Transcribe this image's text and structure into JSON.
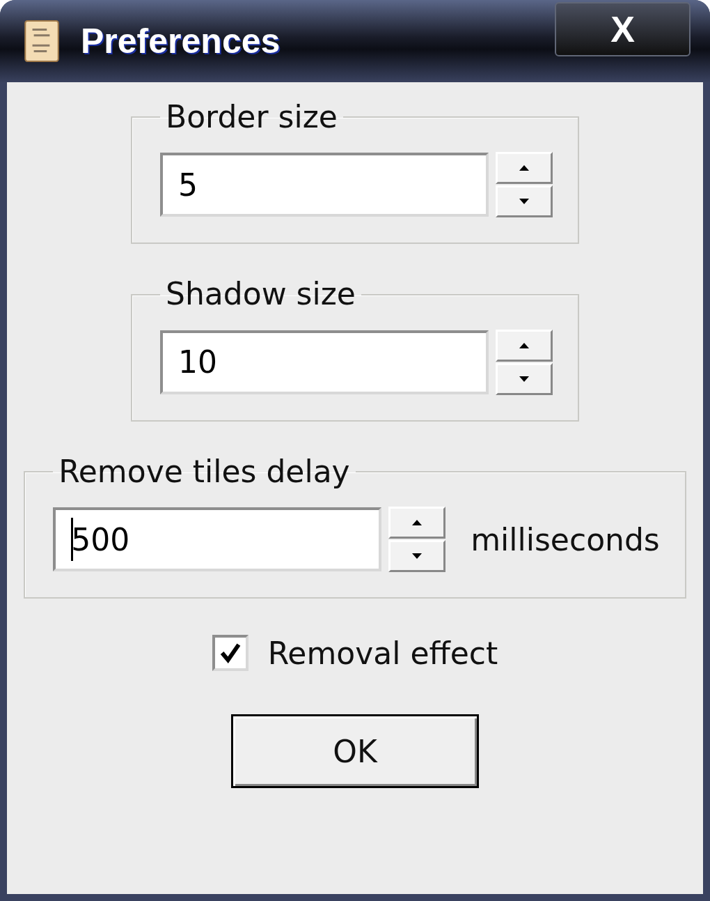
{
  "window": {
    "title": "Preferences",
    "close_label": "X"
  },
  "groups": [
    {
      "label": "Border size",
      "value": "5",
      "focused": false
    },
    {
      "label": "Shadow size",
      "value": "10",
      "focused": false
    },
    {
      "label": "Remove tiles delay",
      "value": "500",
      "focused": true,
      "unit": "milliseconds"
    }
  ],
  "checkbox": {
    "label": "Removal effect",
    "checked": true
  },
  "buttons": [
    "OK"
  ]
}
